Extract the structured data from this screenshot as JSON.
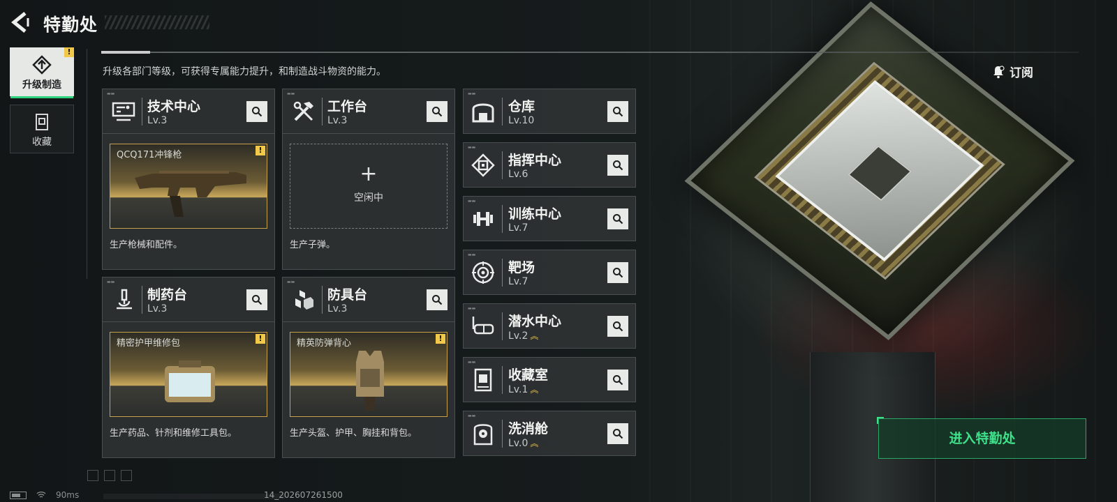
{
  "header": {
    "title": "特勤处",
    "subtitle": "升级各部门等级，可获得专属能力提升，和制造战斗物资的能力。",
    "subscribe_label": "订阅"
  },
  "sidebar": {
    "items": [
      {
        "label": "升级制造",
        "active": true,
        "warning": "!"
      },
      {
        "label": "收藏",
        "active": false
      }
    ]
  },
  "production_cards": [
    {
      "name": "技术中心",
      "level": "Lv.3",
      "product": "QCQ171冲锋枪",
      "warning": "!",
      "desc": "生产枪械和配件。"
    },
    {
      "name": "工作台",
      "level": "Lv.3",
      "plus": "+",
      "idle": "空闲中",
      "desc": "生产子弹。"
    },
    {
      "name": "制药台",
      "level": "Lv.3",
      "product": "精密护甲维修包",
      "warning": "!",
      "desc": "生产药品、针剂和维修工具包。"
    },
    {
      "name": "防具台",
      "level": "Lv.3",
      "product": "精英防弹背心",
      "warning": "!",
      "desc": "生产头盔、护甲、胸挂和背包。"
    }
  ],
  "facilities": [
    {
      "name": "仓库",
      "level": "Lv.10",
      "upgradable": false
    },
    {
      "name": "指挥中心",
      "level": "Lv.6",
      "upgradable": false
    },
    {
      "name": "训练中心",
      "level": "Lv.7",
      "upgradable": false
    },
    {
      "name": "靶场",
      "level": "Lv.7",
      "upgradable": false
    },
    {
      "name": "潜水中心",
      "level": "Lv.2",
      "upgradable": true
    },
    {
      "name": "收藏室",
      "level": "Lv.1",
      "upgradable": true
    },
    {
      "name": "洗消舱",
      "level": "Lv.0",
      "upgradable": true
    }
  ],
  "enter_button": "进入特勤处",
  "status": {
    "ping": "90ms",
    "build": "14_202607261500"
  },
  "colors": {
    "accent_green": "#3fe08a",
    "warning_yellow": "#f2c84b",
    "upgrade_gold": "#e6c14d",
    "product_gold": "#c8a24b"
  },
  "icons": {
    "back": "back-arrow-icon",
    "search": "magnifier-icon",
    "subscribe": "bell-icon",
    "upgrade": "upgrade-arrow-icon",
    "collection": "collection-box-icon"
  }
}
